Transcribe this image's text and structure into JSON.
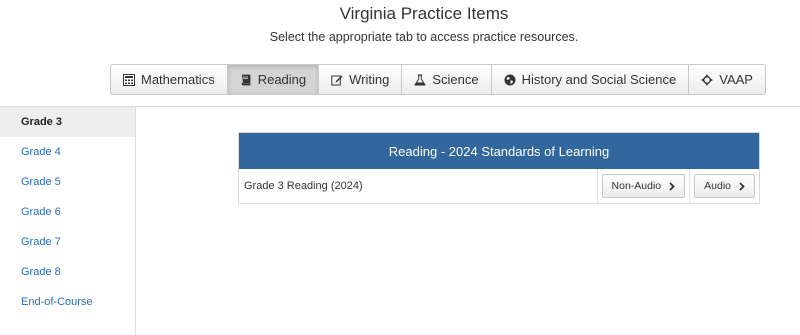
{
  "header": {
    "title": "Virginia Practice Items",
    "subtitle": "Select the appropriate tab to access practice resources."
  },
  "tabs": [
    {
      "label": "Mathematics",
      "icon": "calculator-icon",
      "active": false
    },
    {
      "label": "Reading",
      "icon": "book-icon",
      "active": true
    },
    {
      "label": "Writing",
      "icon": "edit-icon",
      "active": false
    },
    {
      "label": "Science",
      "icon": "flask-icon",
      "active": false
    },
    {
      "label": "History and Social Science",
      "icon": "globe-icon",
      "active": false
    },
    {
      "label": "VAAP",
      "icon": "crosshair-icon",
      "active": false
    }
  ],
  "sidebar": {
    "items": [
      {
        "label": "Grade 3",
        "active": true
      },
      {
        "label": "Grade 4",
        "active": false
      },
      {
        "label": "Grade 5",
        "active": false
      },
      {
        "label": "Grade 6",
        "active": false
      },
      {
        "label": "Grade 7",
        "active": false
      },
      {
        "label": "Grade 8",
        "active": false
      },
      {
        "label": "End-of-Course",
        "active": false
      }
    ]
  },
  "panel": {
    "heading": "Reading - 2024 Standards of Learning",
    "rows": [
      {
        "label": "Grade 3 Reading (2024)",
        "non_audio_label": "Non-Audio",
        "audio_label": "Audio"
      }
    ]
  },
  "colors": {
    "panel_header": "#31679d",
    "link": "#2a6eb6"
  }
}
